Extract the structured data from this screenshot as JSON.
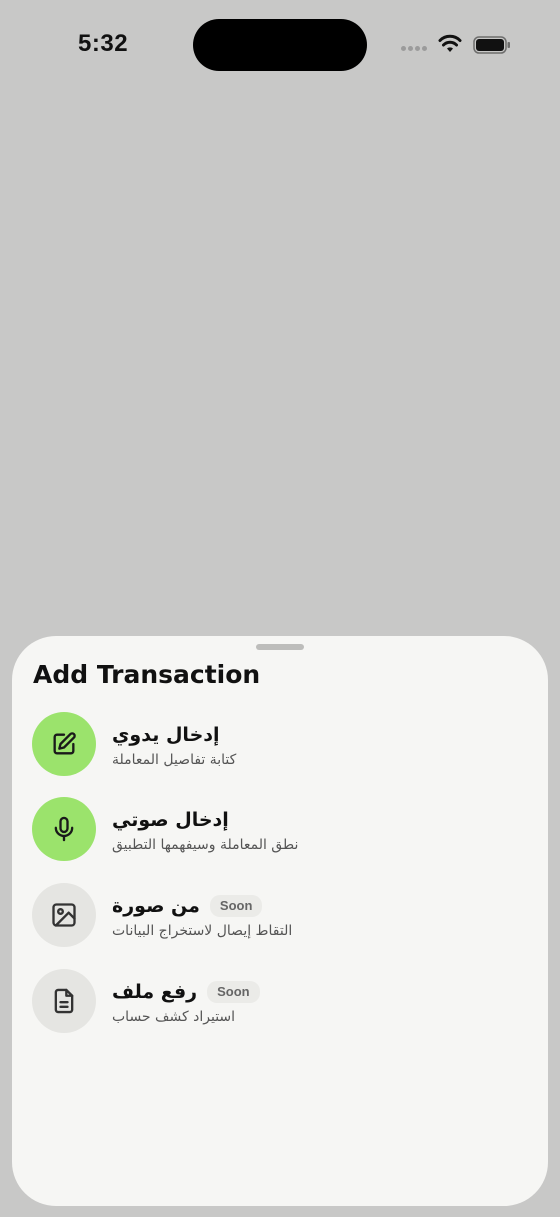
{
  "status_bar": {
    "time": "5:32"
  },
  "sheet": {
    "title": "Add Transaction",
    "options": [
      {
        "title": "إدخال يدوي",
        "subtitle": "كتابة تفاصيل المعاملة",
        "icon": "edit-icon",
        "accent": "#9be36c"
      },
      {
        "title": "إدخال صوتي",
        "subtitle": "نطق المعاملة وسيفهمها التطبيق",
        "icon": "microphone-icon",
        "accent": "#9be36c"
      },
      {
        "title": "من صورة",
        "subtitle": "التقاط إيصال لاستخراج البيانات",
        "icon": "image-icon",
        "badge": "Soon",
        "accent": "#e5e5e2"
      },
      {
        "title": "رفع ملف",
        "subtitle": "استيراد كشف حساب",
        "icon": "file-text-icon",
        "badge": "Soon",
        "accent": "#e5e5e2"
      }
    ]
  }
}
